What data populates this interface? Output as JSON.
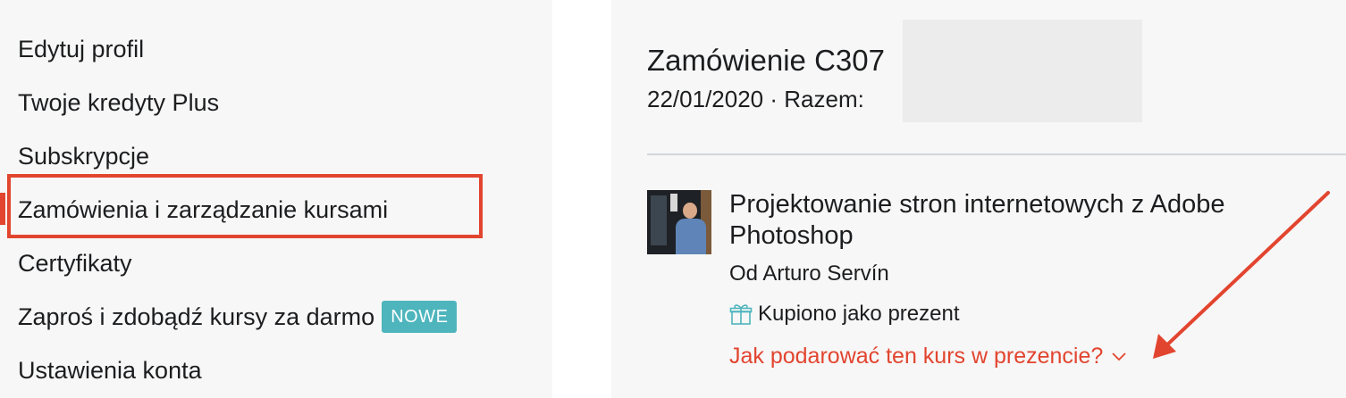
{
  "sidebar": {
    "items": [
      {
        "label": "Edytuj profil"
      },
      {
        "label": "Twoje kredyty Plus"
      },
      {
        "label": "Subskrypcje"
      },
      {
        "label": "Zamówienia i zarządzanie kursami",
        "active": true
      },
      {
        "label": "Certyfikaty"
      },
      {
        "label": "Zaproś i zdobądź kursy za darmo",
        "badge": "NOWE"
      },
      {
        "label": "Ustawienia konta"
      }
    ]
  },
  "order": {
    "title": "Zamówienie C307",
    "date": "22/01/2020",
    "separator": " · ",
    "total_label": "Razem:"
  },
  "course": {
    "title": "Projektowanie stron internetowych z Adobe Photoshop",
    "author": "Od Arturo Servín",
    "gift_status": "Kupiono jako prezent",
    "gift_link": "Jak podarować ten kurs w prezencie?"
  },
  "colors": {
    "accent_red": "#e2452f",
    "badge_teal": "#4eb5bd",
    "panel_bg": "#f7f7f7"
  },
  "icons": {
    "gift": "gift-icon",
    "chevron": "chevron-down-icon"
  }
}
